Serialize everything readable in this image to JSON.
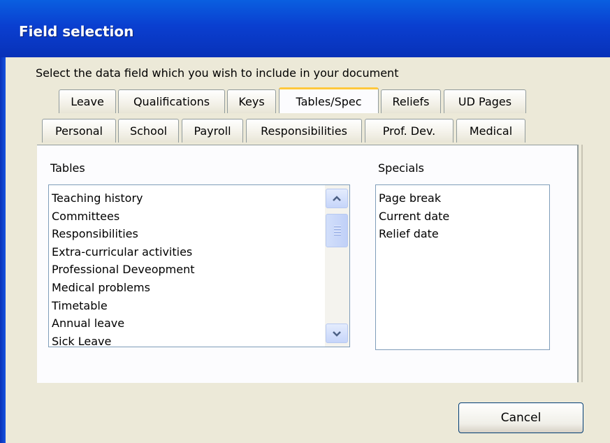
{
  "window": {
    "title": "Field selection"
  },
  "prompt": "Select the data field which you wish to include in your document",
  "tabs_row1": [
    "Leave",
    "Qualifications",
    "Keys",
    "Tables/Spec",
    "Reliefs",
    "UD Pages"
  ],
  "tabs_row2": [
    "Personal",
    "School",
    "Payroll",
    "Responsibilities",
    "Prof. Dev.",
    "Medical"
  ],
  "active_tab": "Tables/Spec",
  "tables": {
    "label": "Tables",
    "items": [
      "Teaching history",
      "Committees",
      "Responsibilities",
      "Extra-curricular activities",
      "Professional Deveopment",
      "Medical problems",
      "Timetable",
      "Annual leave",
      "Sick Leave"
    ]
  },
  "specials": {
    "label": "Specials",
    "items": [
      "Page break",
      "Current date",
      "Relief date"
    ]
  },
  "buttons": {
    "cancel": "Cancel"
  },
  "colors": {
    "titlebar": "#0a3fd0",
    "face": "#ece9d8",
    "active_tab_accent": "#ffc83c"
  }
}
